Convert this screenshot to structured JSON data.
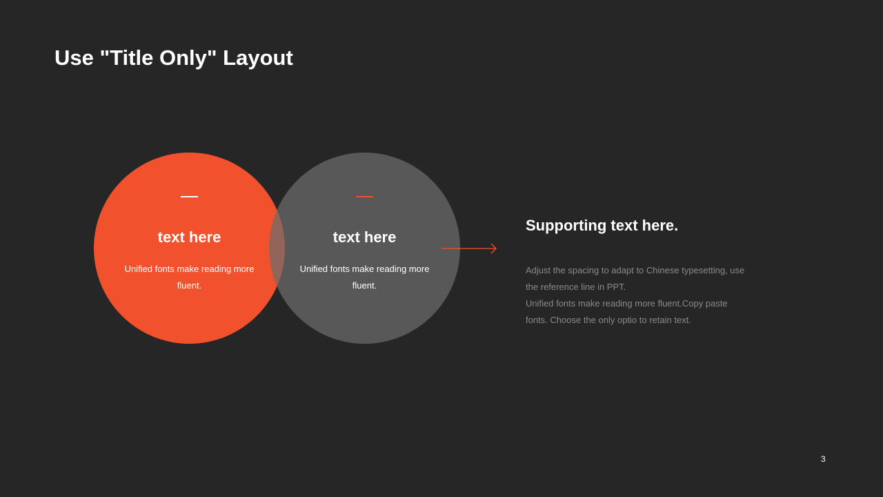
{
  "slide": {
    "title": "Use \"Title Only\" Layout",
    "page_number": "3"
  },
  "circles": [
    {
      "heading": "text here",
      "body": "Unified  fonts make reading more fluent.",
      "fill": "#f2512e",
      "dash_color": "#ffffff"
    },
    {
      "heading": "text here",
      "body": "Unified  fonts make reading more fluent.",
      "fill": "#6c6c6c",
      "dash_color": "#f2512e"
    }
  ],
  "arrow": {
    "icon": "arrow-right-icon",
    "color": "#f2512e"
  },
  "supporting": {
    "title": "Supporting text here.",
    "lines": [
      "Adjust the spacing to adapt to Chinese  typesetting, use",
      "the reference line in PPT.",
      "Unified  fonts make reading more fluent.Copy paste",
      "fonts. Choose the only optio to retain text."
    ]
  },
  "colors": {
    "background": "#262626",
    "accent": "#f2512e",
    "muted_text": "#8a8a8a"
  }
}
